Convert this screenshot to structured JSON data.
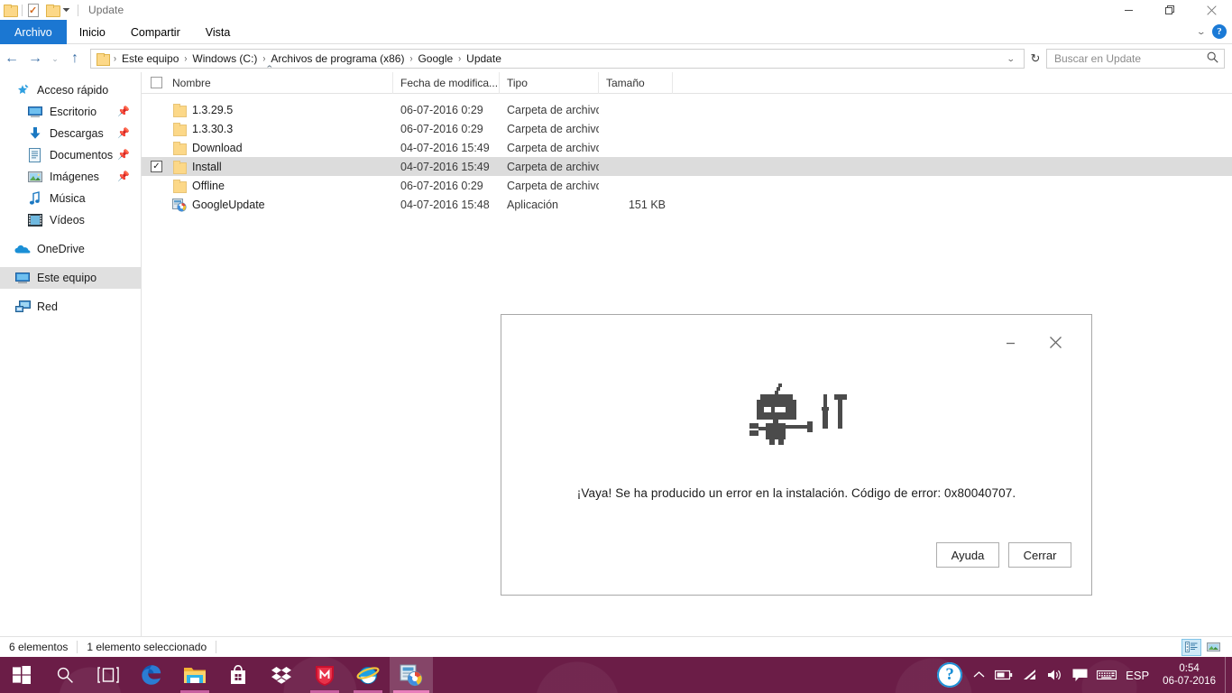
{
  "window": {
    "title": "Update",
    "quick_access": [
      "folder-icon",
      "properties-checkmark-icon",
      "new-folder-icon",
      "customize-caret-icon"
    ],
    "caption_buttons": {
      "minimize": "minimize-icon",
      "maximize": "maximize-icon",
      "close": "close-icon"
    }
  },
  "ribbon": {
    "tabs": [
      {
        "label": "Archivo",
        "active": true
      },
      {
        "label": "Inicio",
        "active": false
      },
      {
        "label": "Compartir",
        "active": false
      },
      {
        "label": "Vista",
        "active": false
      }
    ],
    "collapse_icon": "chevron-down-icon",
    "help_icon": "?"
  },
  "address": {
    "back_icon": "←",
    "forward_icon": "→",
    "recent_icon": "⌄",
    "up_icon": "↑",
    "crumbs": [
      "Este equipo",
      "Windows (C:)",
      "Archivos de programa (x86)",
      "Google",
      "Update"
    ],
    "separator": "›",
    "dropdown_icon": "⌄",
    "refresh_icon": "↻"
  },
  "search": {
    "placeholder": "Buscar en Update",
    "value": "",
    "icon": "search-icon"
  },
  "sidebar": {
    "items": [
      {
        "label": "Acceso rápido",
        "icon": "pin-star-icon",
        "level": 1,
        "pinned": false,
        "selected": false
      },
      {
        "label": "Escritorio",
        "icon": "desktop-icon",
        "level": 2,
        "pinned": true,
        "selected": false
      },
      {
        "label": "Descargas",
        "icon": "downloads-icon",
        "level": 2,
        "pinned": true,
        "selected": false
      },
      {
        "label": "Documentos",
        "icon": "documents-icon",
        "level": 2,
        "pinned": true,
        "selected": false
      },
      {
        "label": "Imágenes",
        "icon": "pictures-icon",
        "level": 2,
        "pinned": true,
        "selected": false
      },
      {
        "label": "Música",
        "icon": "music-icon",
        "level": 2,
        "pinned": false,
        "selected": false
      },
      {
        "label": "Vídeos",
        "icon": "videos-icon",
        "level": 2,
        "pinned": false,
        "selected": false
      },
      {
        "label": "OneDrive",
        "icon": "onedrive-cloud-icon",
        "level": 1,
        "pinned": false,
        "selected": false
      },
      {
        "label": "Este equipo",
        "icon": "this-pc-icon",
        "level": 1,
        "pinned": false,
        "selected": true
      },
      {
        "label": "Red",
        "icon": "network-icon",
        "level": 1,
        "pinned": false,
        "selected": false
      }
    ]
  },
  "filelist": {
    "columns": [
      {
        "key": "name",
        "label": "Nombre",
        "sorted": "asc"
      },
      {
        "key": "date",
        "label": "Fecha de modifica..."
      },
      {
        "key": "type",
        "label": "Tipo"
      },
      {
        "key": "size",
        "label": "Tamaño"
      }
    ],
    "rows": [
      {
        "name": "1.3.29.5",
        "date": "06-07-2016 0:29",
        "type": "Carpeta de archivos",
        "size": "",
        "icon": "folder-icon",
        "checked": false,
        "selected": false
      },
      {
        "name": "1.3.30.3",
        "date": "06-07-2016 0:29",
        "type": "Carpeta de archivos",
        "size": "",
        "icon": "folder-icon",
        "checked": false,
        "selected": false
      },
      {
        "name": "Download",
        "date": "04-07-2016 15:49",
        "type": "Carpeta de archivos",
        "size": "",
        "icon": "folder-icon",
        "checked": false,
        "selected": false
      },
      {
        "name": "Install",
        "date": "04-07-2016 15:49",
        "type": "Carpeta de archivos",
        "size": "",
        "icon": "folder-icon",
        "checked": true,
        "selected": true
      },
      {
        "name": "Offline",
        "date": "06-07-2016 0:29",
        "type": "Carpeta de archivos",
        "size": "",
        "icon": "folder-icon",
        "checked": false,
        "selected": false
      },
      {
        "name": "GoogleUpdate",
        "date": "04-07-2016 15:48",
        "type": "Aplicación",
        "size": "151 KB",
        "icon": "google-update-app-icon",
        "checked": false,
        "selected": false
      }
    ]
  },
  "statusbar": {
    "item_count": "6 elementos",
    "selection": "1 elemento seleccionado",
    "views": [
      {
        "name": "details-view-button",
        "active": true
      },
      {
        "name": "large-icons-view-button",
        "active": false
      }
    ]
  },
  "dialog": {
    "art": "robot-and-tools-pixel-art",
    "message": "¡Vaya! Se ha producido un error en la instalación. Código de error: 0x80040707.",
    "buttons": [
      {
        "label": "Ayuda",
        "name": "help-button"
      },
      {
        "label": "Cerrar",
        "name": "close-button"
      }
    ],
    "minimize_icon": "minimize-icon",
    "close_icon": "close-icon"
  },
  "taskbar": {
    "start_icon": "windows-start-icon",
    "search_icon": "search-icon",
    "taskview_icon": "task-view-icon",
    "apps": [
      {
        "name": "microsoft-edge",
        "running": false
      },
      {
        "name": "file-explorer",
        "running": true
      },
      {
        "name": "microsoft-store",
        "running": false
      },
      {
        "name": "dropbox",
        "running": false
      },
      {
        "name": "mcafee",
        "running": true
      },
      {
        "name": "internet-explorer",
        "running": true
      },
      {
        "name": "google-update",
        "running": true,
        "active": true
      }
    ],
    "tray": {
      "help_icon": "?",
      "chevron_up_icon": "⌃",
      "battery_icon": "battery-icon",
      "wifi_icon": "wifi-icon",
      "volume_icon": "volume-icon",
      "action_center_icon": "action-center-icon",
      "keyboard_icon": "keyboard-icon",
      "language": "ESP",
      "time": "0:54",
      "date": "06-07-2016"
    }
  },
  "colors": {
    "accent_tab": "#1b77d2",
    "taskbar": "#6b1d47",
    "selection_row": "#dcdcdc",
    "nav_selected": "#e0e0e0",
    "folder_yellow": "#fcd888"
  }
}
